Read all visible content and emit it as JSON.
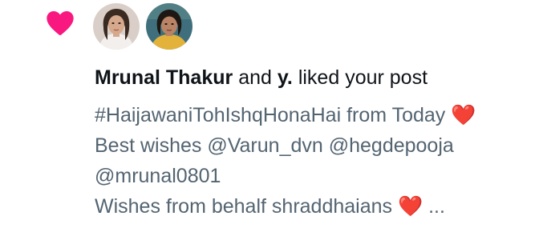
{
  "notification": {
    "type_icon": "heart-icon",
    "type_icon_color": "#f91880",
    "avatars": [
      {
        "name": "avatar-mrunal-thakur",
        "bg": "#d9cfc8",
        "hair": "#3a2a22",
        "skin": "#d6a88c",
        "shirt": "#f2efec"
      },
      {
        "name": "avatar-y",
        "bg": "#3f6f7c",
        "hair": "#1d1612",
        "skin": "#b98466",
        "shirt": "#e2b23a"
      }
    ],
    "summary": {
      "user1": "Mrunal Thakur",
      "and": "and",
      "user2": "y.",
      "action": "liked your post"
    },
    "post": {
      "line1": "#HaijawaniTohIshqHonaHai from Today",
      "line1_emoji": "❤️",
      "line2": "Best wishes @Varun_dvn @hegdepooja",
      "line3": "@mrunal0801",
      "line4": "Wishes from behalf shraddhaians",
      "line4_emoji": "❤️",
      "ellipsis": "..."
    },
    "colors": {
      "primary_text": "#0f1419",
      "secondary_text": "#536471",
      "like_pink": "#f91880",
      "emoji_red": "#e0243b"
    }
  }
}
